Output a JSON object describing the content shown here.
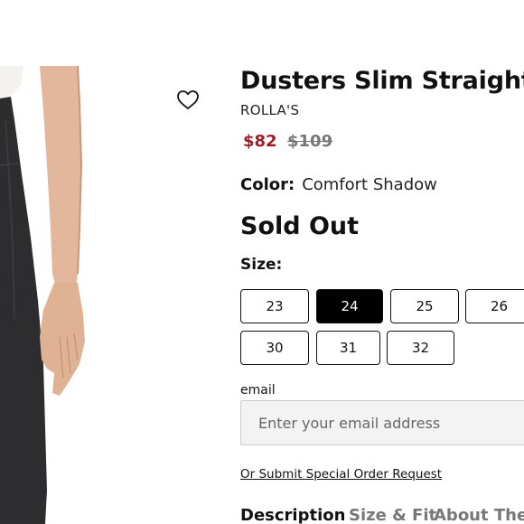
{
  "product": {
    "title": "Dusters Slim Straight",
    "brand": "ROLLA'S",
    "price_sale": "$82",
    "price_original": "$109",
    "color_label": "Color:",
    "color_value": "Comfort Shadow",
    "availability": "Sold Out",
    "size_label": "Size:",
    "sizes": [
      "23",
      "24",
      "25",
      "26",
      "30",
      "31",
      "32"
    ],
    "selected_size": "24"
  },
  "notify": {
    "email_label": "email",
    "email_placeholder": "Enter your email address",
    "special_order_link": "Or Submit Special Order Request"
  },
  "tabs": [
    "Description",
    "Size & Fit",
    "About The"
  ],
  "icons": {
    "wishlist": "heart-outline-icon"
  },
  "colors": {
    "sale_price": "#a01c22",
    "selected_size_bg": "#000000"
  }
}
